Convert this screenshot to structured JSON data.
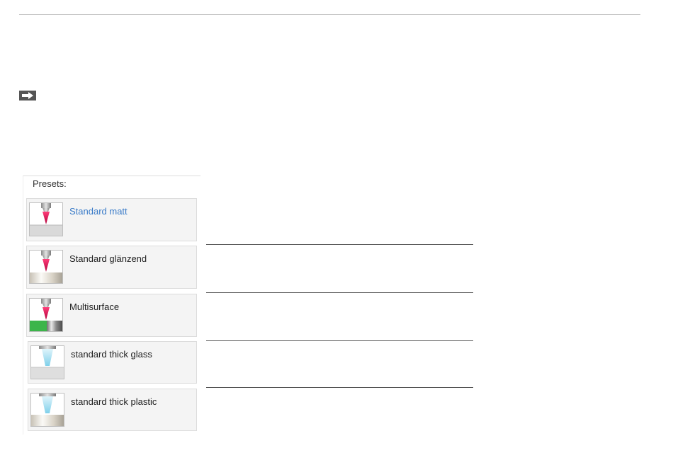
{
  "presets": {
    "title": "Presets:",
    "items": [
      {
        "label": "Standard matt",
        "selected": true,
        "icon": "sensor-matt-icon"
      },
      {
        "label": "Standard glänzend",
        "selected": false,
        "icon": "sensor-glossy-icon"
      },
      {
        "label": "Multisurface",
        "selected": false,
        "icon": "sensor-multisurface-icon"
      },
      {
        "label": "standard thick glass",
        "selected": false,
        "icon": "sensor-thick-glass-icon"
      },
      {
        "label": "standard thick plastic",
        "selected": false,
        "icon": "sensor-thick-plastic-icon"
      }
    ]
  },
  "nav": {
    "arrow_icon": "arrow-right-icon"
  },
  "colors": {
    "selected_label": "#3a7bc8",
    "laser_red": "#e0245a",
    "laser_cyan": "#8fd8ee",
    "multisurface_green": "#3cb54a"
  }
}
